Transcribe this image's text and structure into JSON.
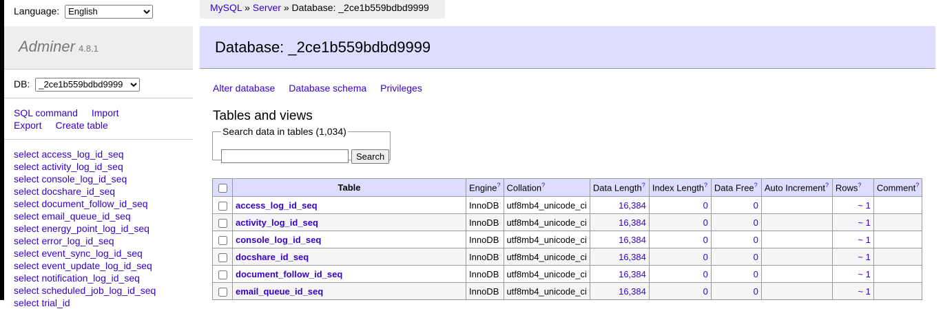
{
  "language": {
    "label": "Language:",
    "selected": "English"
  },
  "app": {
    "name": "Adminer",
    "version": "4.8.1"
  },
  "db": {
    "label": "DB:",
    "selected": "_2ce1b559bdbd9999"
  },
  "links": {
    "sql_command": "SQL command",
    "import": "Import",
    "export": "Export",
    "create_table": "Create table"
  },
  "sidebar_tables": [
    "select access_log_id_seq",
    "select activity_log_id_seq",
    "select console_log_id_seq",
    "select docshare_id_seq",
    "select document_follow_id_seq",
    "select email_queue_id_seq",
    "select energy_point_log_id_seq",
    "select error_log_id_seq",
    "select event_sync_log_id_seq",
    "select event_update_log_id_seq",
    "select notification_log_id_seq",
    "select scheduled_job_log_id_seq",
    "select trial_id"
  ],
  "breadcrumb": {
    "mysql": "MySQL",
    "sep1": " » ",
    "server": "Server",
    "sep2": " » ",
    "current": "Database: _2ce1b559bdbd9999"
  },
  "title": "Database: _2ce1b559bdbd9999",
  "actions": {
    "alter": "Alter database",
    "schema": "Database schema",
    "privileges": "Privileges"
  },
  "section_title": "Tables and views",
  "search": {
    "legend": "Search data in tables (1,034)",
    "button": "Search",
    "value": ""
  },
  "table": {
    "headers": {
      "table": "Table",
      "engine": "Engine",
      "collation": "Collation",
      "data_length": "Data Length",
      "index_length": "Index Length",
      "data_free": "Data Free",
      "auto_increment": "Auto Increment",
      "rows": "Rows",
      "comment": "Comment",
      "help": "?"
    },
    "rows": [
      {
        "name": "access_log_id_seq",
        "engine": "InnoDB",
        "collation": "utf8mb4_unicode_ci",
        "data_length": "16,384",
        "index_length": "0",
        "data_free": "0",
        "auto_increment": "",
        "rows": "~ 1",
        "comment": ""
      },
      {
        "name": "activity_log_id_seq",
        "engine": "InnoDB",
        "collation": "utf8mb4_unicode_ci",
        "data_length": "16,384",
        "index_length": "0",
        "data_free": "0",
        "auto_increment": "",
        "rows": "~ 1",
        "comment": ""
      },
      {
        "name": "console_log_id_seq",
        "engine": "InnoDB",
        "collation": "utf8mb4_unicode_ci",
        "data_length": "16,384",
        "index_length": "0",
        "data_free": "0",
        "auto_increment": "",
        "rows": "~ 1",
        "comment": ""
      },
      {
        "name": "docshare_id_seq",
        "engine": "InnoDB",
        "collation": "utf8mb4_unicode_ci",
        "data_length": "16,384",
        "index_length": "0",
        "data_free": "0",
        "auto_increment": "",
        "rows": "~ 1",
        "comment": ""
      },
      {
        "name": "document_follow_id_seq",
        "engine": "InnoDB",
        "collation": "utf8mb4_unicode_ci",
        "data_length": "16,384",
        "index_length": "0",
        "data_free": "0",
        "auto_increment": "",
        "rows": "~ 1",
        "comment": ""
      },
      {
        "name": "email_queue_id_seq",
        "engine": "InnoDB",
        "collation": "utf8mb4_unicode_ci",
        "data_length": "16,384",
        "index_length": "0",
        "data_free": "0",
        "auto_increment": "",
        "rows": "~ 1",
        "comment": ""
      }
    ]
  }
}
